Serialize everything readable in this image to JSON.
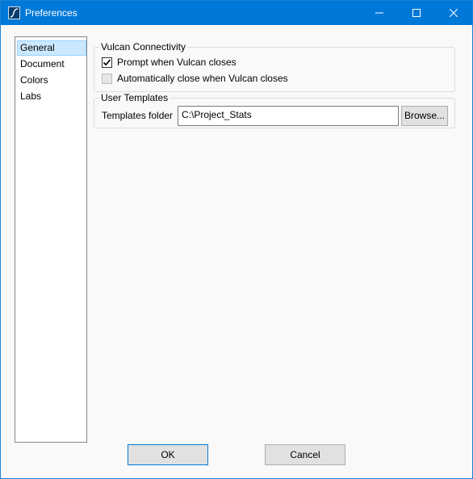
{
  "window": {
    "title": "Preferences"
  },
  "nav": {
    "items": [
      {
        "label": "General",
        "selected": true
      },
      {
        "label": "Document",
        "selected": false
      },
      {
        "label": "Colors",
        "selected": false
      },
      {
        "label": "Labs",
        "selected": false
      }
    ]
  },
  "vulcan": {
    "title": "Vulcan Connectivity",
    "prompt_label": "Prompt when Vulcan closes",
    "prompt_checked": true,
    "autoclose_label": "Automatically close when Vulcan closes",
    "autoclose_checked": false,
    "autoclose_enabled": false
  },
  "templates": {
    "title": "User Templates",
    "folder_label": "Templates folder",
    "folder_value": "C:\\Project_Stats",
    "browse_label": "Browse..."
  },
  "buttons": {
    "ok": "OK",
    "cancel": "Cancel"
  },
  "colors": {
    "titlebar": "#0078d7",
    "selection": "#cce8ff"
  }
}
